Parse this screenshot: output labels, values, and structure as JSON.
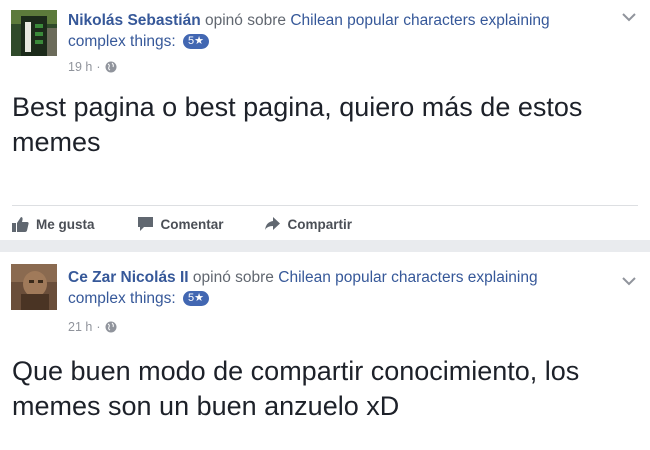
{
  "posts": [
    {
      "author": "Nikolás Sebastián",
      "verb": "opinó sobre",
      "page_name_line1": "Chilean popular characters explaining",
      "page_name_line2": "complex things:",
      "badge": "5★",
      "time": "19 h",
      "separator": "·",
      "text": "Best pagina o best pagina, quiero más de estos memes",
      "actions": {
        "like": "Me gusta",
        "comment": "Comentar",
        "share": "Compartir"
      }
    },
    {
      "author": "Ce Zar Nicolás II",
      "verb": "opinó sobre",
      "page_name_line1": "Chilean popular characters explaining",
      "page_name_line2": "complex things:",
      "badge": "5★",
      "time": "21 h",
      "separator": "·",
      "text": "Que buen modo de compartir conocimiento, los memes son un buen anzuelo xD"
    }
  ],
  "colors": {
    "link": "#365899",
    "badge": "#4267b2",
    "meta": "#90949c",
    "background": "#e9ebee"
  }
}
